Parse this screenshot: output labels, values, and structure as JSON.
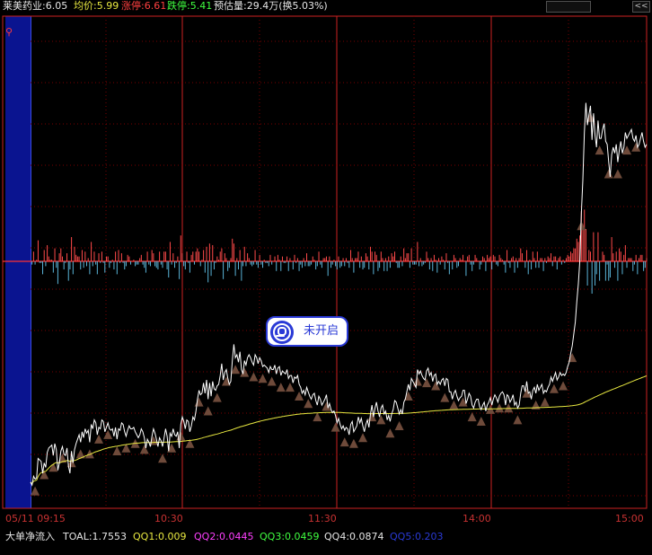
{
  "header": {
    "name_price": "莱美药业:6.05",
    "avg_price": "均价:5.99",
    "limit_up": "涨停:6.61",
    "limit_down": "跌停:5.41",
    "est_volume": "预估量:29.4万(换5.03%)",
    "button_1": "",
    "button_2": "<<"
  },
  "status": {
    "overlay": "未开启"
  },
  "xaxis": {
    "labels": [
      "05/11 09:15",
      "10:30",
      "11:30",
      "14:00",
      "15:00"
    ]
  },
  "indicator": {
    "label": "大单净流入",
    "total": "TOAL:1.7553",
    "qq1": "QQ1:0.009",
    "qq2": "QQ2:0.0445",
    "qq3": "QQ3:0.0459",
    "qq4": "QQ4:0.0874",
    "qq5": "QQ5:0.203"
  },
  "colors": {
    "price_line": "#ffffff",
    "avg_line": "#e8e840",
    "limit_up": "#ff4040",
    "limit_down": "#40ff40",
    "grid": "#7a0000",
    "axis": "#cc2222",
    "triangle": "#6e4a3a",
    "flow_pos": "#ff4a4a",
    "flow_neg": "#5ab4d8"
  },
  "chart_data": {
    "type": "line",
    "series": [
      {
        "values": [
          0.14,
          0.12,
          0.18,
          0.16,
          0.17,
          0.3,
          0.29,
          0.28,
          0.2,
          0.27,
          0.24,
          0.34,
          0.37,
          0.38,
          0.39,
          0.32,
          0.4,
          0.36,
          0.22,
          0.27,
          0.35,
          0.38,
          0.33,
          0.32,
          0.37,
          0.25,
          0.2,
          0.35,
          0.27,
          0.36,
          0.4,
          0.43,
          0.46,
          0.41,
          0.48,
          0.44,
          0.5,
          0.47,
          0.49,
          0.41,
          0.53,
          0.5,
          0.56,
          0.54,
          0.46,
          0.51,
          0.5,
          0.56,
          0.55,
          0.48,
          0.51,
          0.54,
          0.5,
          0.49,
          0.5,
          0.45,
          0.51,
          0.43,
          0.5,
          0.49,
          0.54,
          0.53,
          0.48,
          0.45,
          0.49,
          0.52,
          0.5,
          0.5,
          0.51,
          0.48,
          0.46,
          0.44,
          0.46,
          0.5,
          0.48,
          0.44,
          0.37,
          0.43,
          0.41,
          0.38,
          0.45,
          0.5,
          0.47,
          0.43,
          0.38,
          0.44,
          0.42,
          0.38,
          0.44,
          0.5,
          0.45,
          0.35,
          0.47,
          0.45,
          0.5,
          0.46,
          0.45,
          0.48,
          0.37,
          0.53,
          0.58,
          0.55,
          0.5,
          0.56,
          0.55,
          0.48,
          0.52,
          0.58,
          0.56,
          0.62,
          0.7,
          0.76,
          0.73,
          0.74,
          0.81,
          0.74,
          0.83,
          0.7,
          0.81,
          0.72,
          0.82,
          0.77,
          0.76,
          0.79,
          0.8,
          0.86,
          0.94,
          0.83,
          0.88,
          0.9,
          0.84,
          0.8,
          0.82,
          0.96,
          1.07,
          0.98,
          1.0,
          0.95,
          1.02,
          0.9,
          0.87,
          0.96,
          0.93,
          0.98,
          1.0,
          0.98,
          0.95,
          0.93,
          1.0,
          0.98,
          0.94,
          0.98,
          0.96,
          0.92,
          0.93,
          0.92,
          0.91,
          0.88,
          0.92,
          0.9,
          0.9,
          0.93,
          0.87,
          0.91,
          0.92,
          0.86,
          0.89,
          0.88,
          0.87,
          0.9,
          0.84,
          0.86,
          0.86,
          0.81,
          0.85,
          0.84,
          0.86,
          0.8,
          0.78,
          0.74,
          0.76,
          0.73,
          0.78,
          0.75,
          0.72,
          0.7,
          0.73,
          0.74,
          0.69,
          0.66,
          0.72,
          0.7,
          0.66,
          0.68,
          0.7,
          0.73,
          0.64,
          0.67,
          0.63,
          0.61,
          0.62,
          0.59,
          0.54,
          0.57,
          0.53,
          0.5,
          0.52,
          0.49,
          0.51,
          0.5,
          0.46,
          0.53,
          0.55,
          0.48,
          0.5,
          0.52,
          0.58,
          0.54,
          0.57,
          0.52,
          0.48,
          0.53,
          0.56,
          0.51,
          0.6,
          0.66,
          0.58,
          0.64,
          0.68,
          0.62,
          0.58,
          0.64,
          0.66,
          0.6,
          0.62,
          0.56,
          0.59,
          0.55,
          0.6,
          0.63,
          0.69,
          0.68,
          0.64,
          0.6,
          0.63,
          0.6,
          0.68,
          0.7,
          0.75,
          0.8,
          0.76,
          0.84,
          0.82,
          0.8,
          0.78,
          0.9,
          0.87,
          0.89,
          0.86,
          0.84,
          0.83,
          0.89,
          0.91,
          0.86,
          0.88,
          0.82,
          0.86,
          0.87,
          0.8,
          0.82,
          0.8,
          0.83,
          0.84,
          0.79,
          0.84,
          0.83,
          0.75,
          0.75,
          0.7,
          0.74,
          0.76,
          0.72,
          0.69,
          0.71,
          0.72,
          0.76,
          0.76,
          0.67,
          0.7,
          0.74,
          0.72,
          0.66,
          0.64,
          0.68,
          0.7,
          0.7,
          0.65,
          0.63,
          0.66,
          0.68,
          0.62,
          0.66,
          0.68,
          0.71,
          0.66,
          0.7,
          0.73,
          0.71,
          0.68,
          0.72,
          0.74,
          0.75,
          0.73,
          0.66,
          0.73,
          0.72,
          0.68,
          0.7,
          0.73,
          0.66,
          0.68,
          0.64,
          0.66,
          0.74,
          0.79,
          0.79,
          0.75,
          0.82,
          0.74,
          0.75,
          0.7,
          0.76,
          0.78,
          0.74,
          0.8,
          0.76,
          0.78,
          0.8,
          0.74,
          0.76,
          0.75,
          0.78,
          0.8,
          0.85,
          0.82,
          0.85,
          0.88,
          0.83,
          0.85,
          0.88,
          0.86,
          0.87,
          0.86,
          0.88,
          0.92,
          0.95,
          1.01,
          1.06,
          1.14,
          1.22,
          1.36,
          1.48,
          1.64,
          1.95,
          2.18,
          2.5,
          2.7,
          2.55,
          2.62,
          2.68,
          2.45,
          2.63,
          2.48,
          2.4,
          2.58,
          2.46,
          2.46,
          2.52,
          2.56,
          2.44,
          2.42,
          2.3,
          2.2,
          2.35,
          2.4,
          2.36,
          2.42,
          2.3,
          2.38,
          2.44,
          2.36,
          2.4,
          2.5,
          2.46,
          2.48,
          2.5,
          2.52,
          2.46,
          2.44,
          2.48,
          2.4,
          2.42,
          2.46,
          2.5,
          2.44,
          2.4,
          2.42
        ]
      }
    ]
  }
}
